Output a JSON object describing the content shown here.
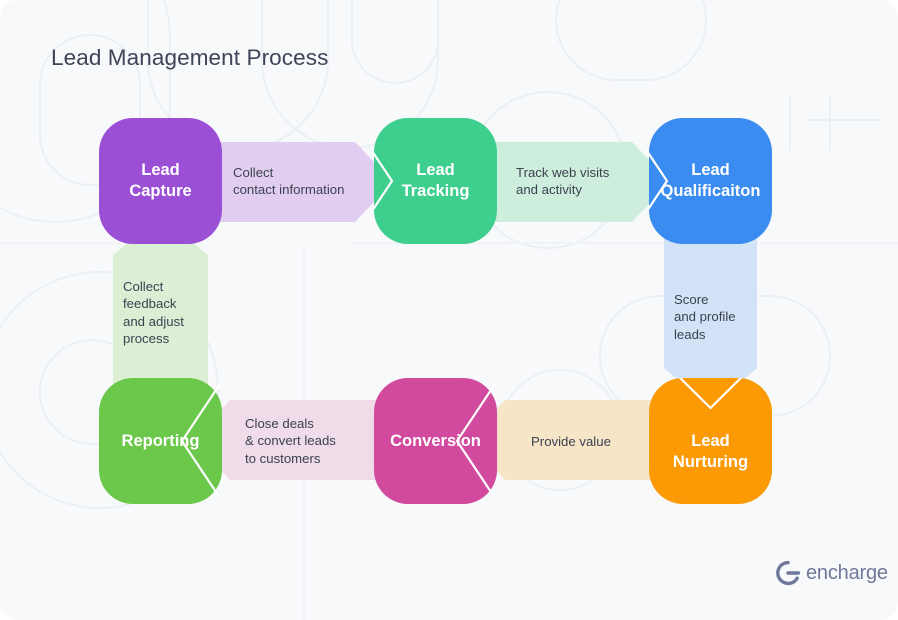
{
  "page": {
    "title": "Lead Management Process",
    "background_color": "#f7f9fb",
    "title_color": "#3e4559"
  },
  "diagram": {
    "type": "process-flow",
    "nodes": [
      {
        "id": "lead-capture",
        "label": "Lead\nCapture",
        "color": "#9b4fd4",
        "row": "top",
        "order": 1
      },
      {
        "id": "lead-tracking",
        "label": "Lead\nTracking",
        "color": "#3ecf8e",
        "row": "top",
        "order": 2
      },
      {
        "id": "lead-qualificaiton",
        "label": "Lead\nQualificaiton",
        "color": "#3b8cf0",
        "row": "top",
        "order": 3
      },
      {
        "id": "lead-nurturing",
        "label": "Lead\nNurturing",
        "color": "#fb9a04",
        "row": "bottom",
        "order": 4
      },
      {
        "id": "conversion",
        "label": "Conversion",
        "color": "#d14a9e",
        "row": "bottom",
        "order": 5
      },
      {
        "id": "reporting",
        "label": "Reporting",
        "color": "#6cc council"
      }
    ],
    "connectors": [
      {
        "id": "collect-contact-information",
        "label": "Collect\ncontact information",
        "color": "#e0cdef",
        "from": "lead-capture",
        "to": "lead-tracking",
        "direction": "right"
      },
      {
        "id": "track-web-visits",
        "label": "Track web visits\nand activity",
        "color": "#cdeedd",
        "from": "lead-tracking",
        "to": "lead-qualificaiton",
        "direction": "right"
      },
      {
        "id": "score-and-profile-leads",
        "label": "Score\nand profile\nleads",
        "color": "#d2e3f7",
        "from": "lead-qualificaiton",
        "to": "lead-nurturing",
        "direction": "down"
      },
      {
        "id": "provide-value",
        "label": "Provide value",
        "color": "#f7e5c8",
        "from": "lead-nurturing",
        "to": "conversion",
        "direction": "left"
      },
      {
        "id": "close-deals",
        "label": "Close deals\n& convert leads\nto customers",
        "color": "#f0dbe8",
        "from": "conversion",
        "to": "reporting",
        "direction": "left"
      },
      {
        "id": "collect-feedback",
        "label": "Collect\nfeedback\nand adjust\nprocess",
        "color": "#dcefd5",
        "from": "reporting",
        "to": "lead-capture",
        "direction": "up"
      }
    ]
  },
  "brand": {
    "logo_text": "encharge",
    "logo_color": "#6f7899"
  }
}
